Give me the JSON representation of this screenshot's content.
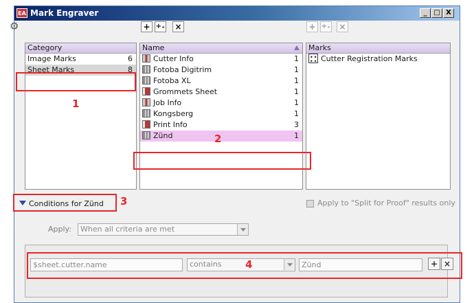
{
  "window": {
    "title": "Mark Engraver",
    "app_icon": "EA",
    "controls": [
      "_",
      "□",
      "X"
    ]
  },
  "toolbar": {
    "gear_icon": "gear-icon",
    "name_buttons": [
      "+",
      "+₊",
      "×"
    ],
    "marks_buttons": [
      "+",
      "+₊",
      "×"
    ]
  },
  "category_panel": {
    "header": "Category",
    "items": [
      {
        "label": "Image Marks",
        "count": "6"
      },
      {
        "label": "Sheet Marks",
        "count": "8"
      }
    ]
  },
  "name_panel": {
    "header": "Name",
    "items": [
      {
        "label": "Cutter Info",
        "count": "1"
      },
      {
        "label": "Fotoba Digitrim",
        "count": "1"
      },
      {
        "label": "Fotoba XL",
        "count": "1"
      },
      {
        "label": "Grommets Sheet",
        "count": "1"
      },
      {
        "label": "Job Info",
        "count": "1"
      },
      {
        "label": "Kongsberg",
        "count": "1"
      },
      {
        "label": "Print Info",
        "count": "3"
      },
      {
        "label": "Zünd",
        "count": "1"
      }
    ]
  },
  "marks_panel": {
    "header": "Marks",
    "items": [
      {
        "label": "Cutter Registration Marks"
      }
    ]
  },
  "conditions": {
    "label": "Conditions for Zünd",
    "split_proof_label": "Apply to \"Split for Proof\" results only",
    "apply_label": "Apply:",
    "apply_value": "When all criteria are met"
  },
  "criteria": {
    "field": "$sheet.cutter.name",
    "operator": "contains",
    "value": "Zünd",
    "add_button": "+",
    "remove_button": "×"
  },
  "annotations": [
    "1",
    "2",
    "3",
    "4"
  ],
  "colors": {
    "annotation": "#e8262a",
    "header_bg": "#d3c4e6",
    "selected_pink": "#f0c4f0"
  }
}
